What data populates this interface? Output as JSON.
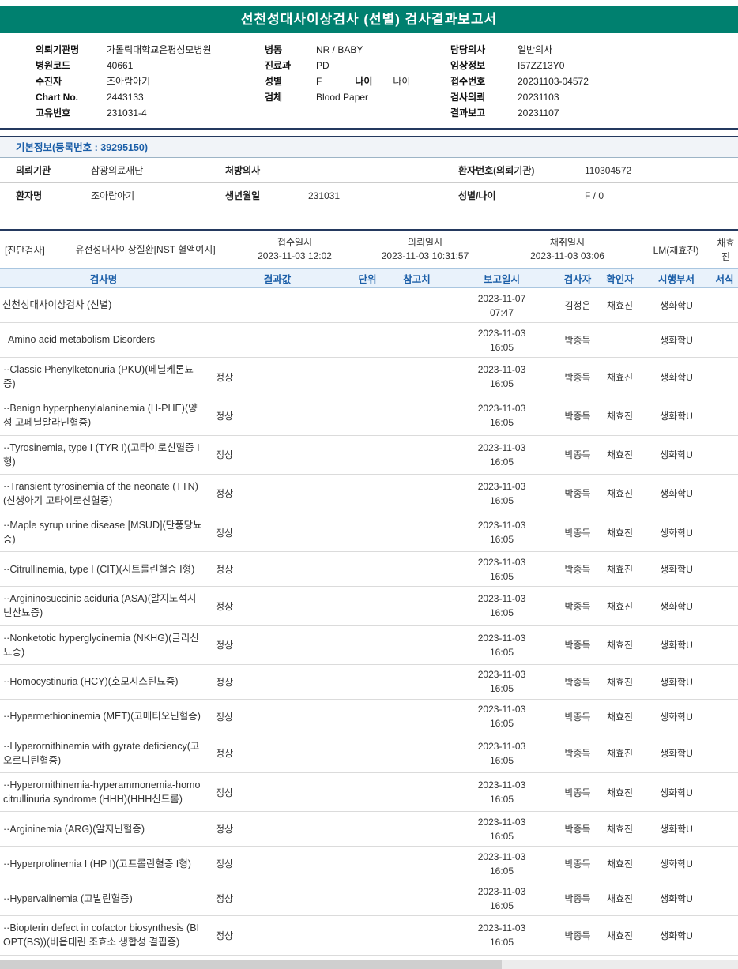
{
  "title": "선천성대사이상검사 (선별) 검사결과보고서",
  "colors": {
    "accent_teal": "#00806F",
    "navy_line": "#24395F",
    "header_blue_text": "#1C5FA8",
    "table_header_bg": "#E9F2FB"
  },
  "patient_info": {
    "col1": [
      {
        "label": "의뢰기관명",
        "value": "가톨릭대학교은평성모병원"
      },
      {
        "label": "병원코드",
        "value": "40661"
      },
      {
        "label": "수진자",
        "value": "조아람아기"
      },
      {
        "label": "Chart No.",
        "value": "2443133"
      },
      {
        "label": "고유번호",
        "value": "231031-4"
      }
    ],
    "col2": [
      {
        "label": "병동",
        "value": "NR / BABY"
      },
      {
        "label": "진료과",
        "value": "PD"
      },
      {
        "label": "성별",
        "value": "F",
        "label2": "나이",
        "value2": "나이"
      },
      {
        "label": "검체",
        "value": "Blood Paper"
      }
    ],
    "col3": [
      {
        "label": "담당의사",
        "value": "일반의사"
      },
      {
        "label": "임상정보",
        "value": "I57ZZ13Y0"
      },
      {
        "label": "접수번호",
        "value": "20231103-04572"
      },
      {
        "label": "검사의뢰",
        "value": "20231103"
      },
      {
        "label": "결과보고",
        "value": "20231107"
      }
    ]
  },
  "basic_info": {
    "section_title": "기본정보(등록번호 : 39295150)",
    "rows": [
      [
        {
          "label": "의뢰기관",
          "value": "삼광의료재단"
        },
        {
          "label": "처방의사",
          "value": ""
        },
        {
          "label": "환자번호(의뢰기관)",
          "value": "110304572"
        }
      ],
      [
        {
          "label": "환자명",
          "value": "조아람아기"
        },
        {
          "label": "생년월일",
          "value": "231031"
        },
        {
          "label": "성별/나이",
          "value": "F / 0"
        }
      ]
    ]
  },
  "order_info": {
    "tag": "[진단검사]",
    "test_group": "유전성대사이상질환[NST 혈액여지]",
    "datetimes": [
      {
        "label": "접수일시",
        "value": "2023-11-03 12:02"
      },
      {
        "label": "의뢰일시",
        "value": "2023-11-03 10:31:57"
      },
      {
        "label": "채취일시",
        "value": "2023-11-03 03:06"
      }
    ],
    "collector": "LM(채효진)",
    "confirmer": "채효진"
  },
  "results": {
    "headers": [
      "검사명",
      "결과값",
      "단위",
      "참고치",
      "보고일시",
      "검사자",
      "확인자",
      "시행부서",
      "서식"
    ],
    "rows": [
      {
        "name": "선천성대사이상검사 (선별)",
        "result": "",
        "unit": "",
        "ref": "",
        "date": "2023-11-07 07:47",
        "tester": "김정은",
        "confirmer": "채효진",
        "dept": "생화학U",
        "form": "",
        "indent": 0
      },
      {
        "name": "Amino acid metabolism Disorders",
        "result": "",
        "unit": "",
        "ref": "",
        "date": "2023-11-03 16:05",
        "tester": "박종득",
        "confirmer": "",
        "dept": "생화학U",
        "form": "",
        "indent": 1
      },
      {
        "name": "··Classic Phenylketonuria (PKU)(페닐케톤뇨증)",
        "result": "정상",
        "unit": "",
        "ref": "",
        "date": "2023-11-03 16:05",
        "tester": "박종득",
        "confirmer": "채효진",
        "dept": "생화학U",
        "form": "",
        "indent": 2
      },
      {
        "name": "··Benign hyperphenylalaninemia (H-PHE)(양성 고페닐알라닌혈증)",
        "result": "정상",
        "unit": "",
        "ref": "",
        "date": "2023-11-03 16:05",
        "tester": "박종득",
        "confirmer": "채효진",
        "dept": "생화학U",
        "form": "",
        "indent": 2
      },
      {
        "name": "··Tyrosinemia, type I (TYR I)(고타이로신혈증 I형)",
        "result": "정상",
        "unit": "",
        "ref": "",
        "date": "2023-11-03 16:05",
        "tester": "박종득",
        "confirmer": "채효진",
        "dept": "생화학U",
        "form": "",
        "indent": 2
      },
      {
        "name": "··Transient tyrosinemia of the neonate (TTN)(신생아기 고타이로신혈증)",
        "result": "정상",
        "unit": "",
        "ref": "",
        "date": "2023-11-03 16:05",
        "tester": "박종득",
        "confirmer": "채효진",
        "dept": "생화학U",
        "form": "",
        "indent": 2
      },
      {
        "name": "··Maple syrup urine disease [MSUD](단풍당뇨증)",
        "result": "정상",
        "unit": "",
        "ref": "",
        "date": "2023-11-03 16:05",
        "tester": "박종득",
        "confirmer": "채효진",
        "dept": "생화학U",
        "form": "",
        "indent": 2
      },
      {
        "name": "··Citrullinemia, type I (CIT)(시트룰린혈증 I형)",
        "result": "정상",
        "unit": "",
        "ref": "",
        "date": "2023-11-03 16:05",
        "tester": "박종득",
        "confirmer": "채효진",
        "dept": "생화학U",
        "form": "",
        "indent": 2
      },
      {
        "name": "··Argininosuccinic aciduria (ASA)(알지노석시닌산뇨증)",
        "result": "정상",
        "unit": "",
        "ref": "",
        "date": "2023-11-03 16:05",
        "tester": "박종득",
        "confirmer": "채효진",
        "dept": "생화학U",
        "form": "",
        "indent": 2
      },
      {
        "name": "··Nonketotic hyperglycinemia (NKHG)(글리신뇨증)",
        "result": "정상",
        "unit": "",
        "ref": "",
        "date": "2023-11-03 16:05",
        "tester": "박종득",
        "confirmer": "채효진",
        "dept": "생화학U",
        "form": "",
        "indent": 2
      },
      {
        "name": "··Homocystinuria (HCY)(호모시스틴뇨증)",
        "result": "정상",
        "unit": "",
        "ref": "",
        "date": "2023-11-03 16:05",
        "tester": "박종득",
        "confirmer": "채효진",
        "dept": "생화학U",
        "form": "",
        "indent": 2
      },
      {
        "name": "··Hypermethioninemia (MET)(고메티오닌혈증)",
        "result": "정상",
        "unit": "",
        "ref": "",
        "date": "2023-11-03 16:05",
        "tester": "박종득",
        "confirmer": "채효진",
        "dept": "생화학U",
        "form": "",
        "indent": 2
      },
      {
        "name": "··Hyperornithinemia with gyrate deficiency(고오르니틴혈증)",
        "result": "정상",
        "unit": "",
        "ref": "",
        "date": "2023-11-03 16:05",
        "tester": "박종득",
        "confirmer": "채효진",
        "dept": "생화학U",
        "form": "",
        "indent": 2
      },
      {
        "name": "··Hyperornithinemia-hyperammonemia-homocitrullinuria syndrome (HHH)(HHH신드롬)",
        "result": "정상",
        "unit": "",
        "ref": "",
        "date": "2023-11-03 16:05",
        "tester": "박종득",
        "confirmer": "채효진",
        "dept": "생화학U",
        "form": "",
        "indent": 2
      },
      {
        "name": "··Argininemia (ARG)(알지닌혈증)",
        "result": "정상",
        "unit": "",
        "ref": "",
        "date": "2023-11-03 16:05",
        "tester": "박종득",
        "confirmer": "채효진",
        "dept": "생화학U",
        "form": "",
        "indent": 2
      },
      {
        "name": "··Hyperprolinemia I (HP I)(고프롤린혈증 I형)",
        "result": "정상",
        "unit": "",
        "ref": "",
        "date": "2023-11-03 16:05",
        "tester": "박종득",
        "confirmer": "채효진",
        "dept": "생화학U",
        "form": "",
        "indent": 2
      },
      {
        "name": "··Hypervalinemia (고발린혈증)",
        "result": "정상",
        "unit": "",
        "ref": "",
        "date": "2023-11-03 16:05",
        "tester": "박종득",
        "confirmer": "채효진",
        "dept": "생화학U",
        "form": "",
        "indent": 2
      },
      {
        "name": "··Biopterin defect in cofactor biosynthesis (BIOPT(BS))(비옵테린 조효소 생합성 결핍증)",
        "result": "정상",
        "unit": "",
        "ref": "",
        "date": "2023-11-03 16:05",
        "tester": "박종득",
        "confirmer": "채효진",
        "dept": "생화학U",
        "form": "",
        "indent": 2
      }
    ]
  }
}
